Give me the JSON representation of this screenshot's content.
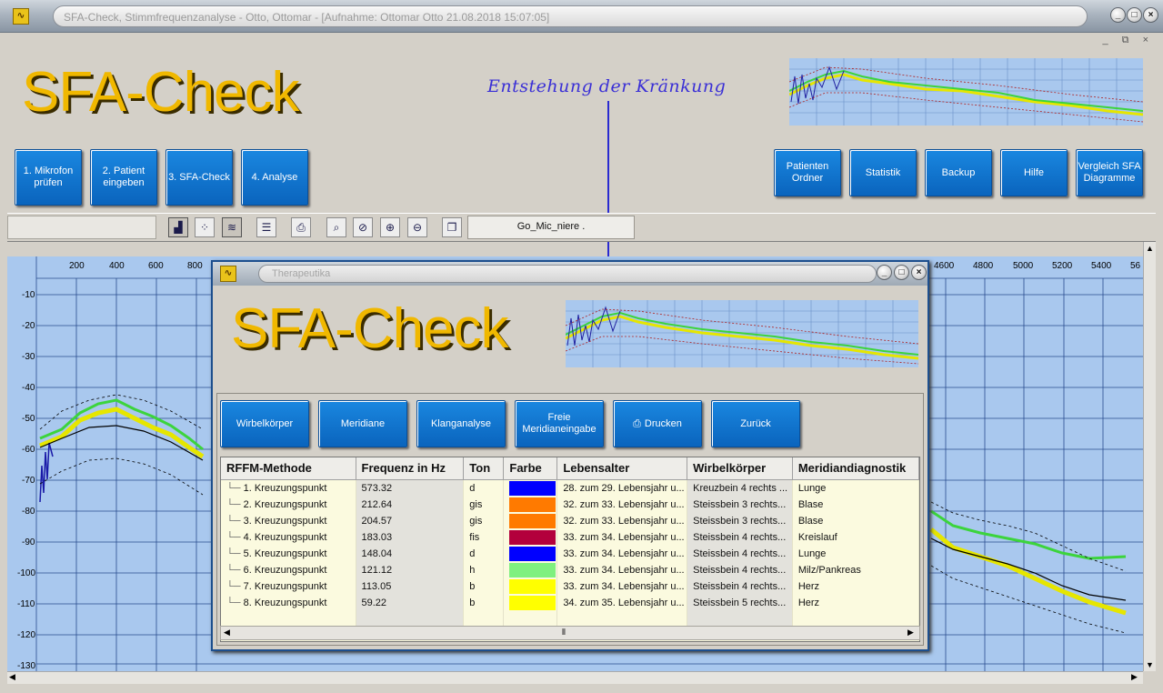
{
  "window": {
    "title": "SFA-Check, Stimmfrequenzanalyse - Otto, Ottomar - [Aufnahme: Ottomar Otto 21.08.2018 15:07:05]",
    "app_icon": "waveform-icon",
    "controls": [
      "_",
      "□",
      "×"
    ]
  },
  "header": {
    "logo": "SFA-Check",
    "annotation": "Entstehung der Kränkung",
    "left_buttons": [
      "1. Mikrofon prüfen",
      "2. Patient eingeben",
      "3. SFA-Check",
      "4. Analyse"
    ],
    "right_buttons": [
      "Patienten Ordner",
      "Statistik",
      "Backup",
      "Hilfe",
      "Vergleich SFA Diagramme"
    ]
  },
  "toolbar": {
    "icons": [
      "spectrum-view-icon",
      "scatter-view-icon",
      "contour-view-icon",
      "lines-icon",
      "print-icon",
      "zoom-icon",
      "zoom-reset-icon",
      "zoom-in-icon",
      "zoom-out-icon",
      "window-icon"
    ],
    "mic_field": "Go_Mic_niere ."
  },
  "chart_axes": {
    "x_ticks_left": [
      "200",
      "400",
      "600",
      "800"
    ],
    "x_ticks_right": [
      "4600",
      "4800",
      "5000",
      "5200",
      "5400",
      "56"
    ],
    "y_ticks": [
      "-10",
      "-20",
      "-30",
      "-40",
      "-50",
      "-60",
      "-70",
      "-80",
      "-90",
      "-100",
      "-110",
      "-120",
      "-130"
    ]
  },
  "dialog": {
    "title": "Therapeutika",
    "logo": "SFA-Check",
    "buttons": [
      "Wirbelkörper",
      "Meridiane",
      "Klanganalyse",
      "Freie Meridianeingabe",
      "Drucken",
      "Zurück"
    ],
    "columns": [
      "RFFM-Methode",
      "Frequenz in Hz",
      "Ton",
      "Farbe",
      "Lebensalter",
      "Wirbelkörper",
      "Meridiandiagnostik"
    ],
    "rows": [
      {
        "method": "1. Kreuzungspunkt",
        "freq": "573.32",
        "ton": "d",
        "color": "#0000ff",
        "age": "28. zum 29. Lebensjahr u...",
        "wk": "Kreuzbein 4  rechts ...",
        "meridian": "Lunge"
      },
      {
        "method": "2. Kreuzungspunkt",
        "freq": "212.64",
        "ton": "gis",
        "color": "#ff7a00",
        "age": "32. zum 33. Lebensjahr u...",
        "wk": "Steissbein 3  rechts...",
        "meridian": "Blase"
      },
      {
        "method": "3. Kreuzungspunkt",
        "freq": "204.57",
        "ton": "gis",
        "color": "#ff7a00",
        "age": "32. zum 33. Lebensjahr u...",
        "wk": "Steissbein 3  rechts...",
        "meridian": "Blase"
      },
      {
        "method": "4. Kreuzungspunkt",
        "freq": "183.03",
        "ton": "fis",
        "color": "#b3003c",
        "age": "33. zum 34. Lebensjahr u...",
        "wk": "Steissbein 4  rechts...",
        "meridian": "Kreislauf"
      },
      {
        "method": "5. Kreuzungspunkt",
        "freq": "148.04",
        "ton": "d",
        "color": "#0000ff",
        "age": "33. zum 34. Lebensjahr u...",
        "wk": "Steissbein 4  rechts...",
        "meridian": "Lunge"
      },
      {
        "method": "6. Kreuzungspunkt",
        "freq": "121.12",
        "ton": "h",
        "color": "#7ff07f",
        "age": "33. zum 34. Lebensjahr u...",
        "wk": "Steissbein 4  rechts...",
        "meridian": "Milz/Pankreas"
      },
      {
        "method": "7. Kreuzungspunkt",
        "freq": "113.05",
        "ton": "b",
        "color": "#ffff00",
        "age": "33. zum 34. Lebensjahr u...",
        "wk": "Steissbein 4  rechts...",
        "meridian": "Herz"
      },
      {
        "method": "8. Kreuzungspunkt",
        "freq": "59.22",
        "ton": "b",
        "color": "#ffff00",
        "age": "34. zum 35. Lebensjahr u...",
        "wk": "Steissbein 5  rechts...",
        "meridian": "Herz"
      }
    ]
  }
}
